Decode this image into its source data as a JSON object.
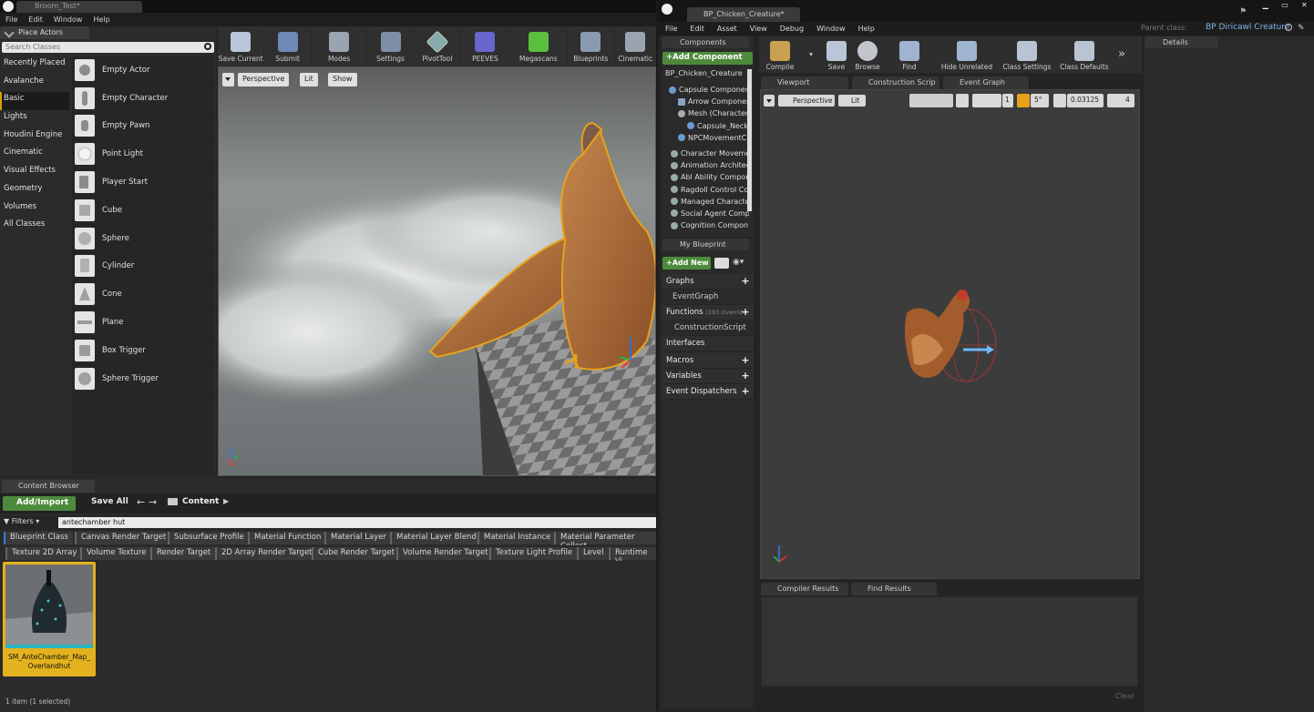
{
  "left_editor": {
    "doc_tab": "Broom_Test*",
    "menu": [
      "File",
      "Edit",
      "Window",
      "Help"
    ],
    "place_actors": {
      "tab_label": "Place Actors",
      "search_placeholder": "Search Classes",
      "categories": [
        "Recently Placed",
        "Avalanche",
        "Basic",
        "Lights",
        "Houdini Engine",
        "Cinematic",
        "Visual Effects",
        "Geometry",
        "Volumes",
        "All Classes"
      ],
      "selected_category": "Basic",
      "items": [
        "Empty Actor",
        "Empty Character",
        "Empty Pawn",
        "Point Light",
        "Player Start",
        "Cube",
        "Sphere",
        "Cylinder",
        "Cone",
        "Plane",
        "Box Trigger",
        "Sphere Trigger"
      ]
    },
    "toolbar": [
      {
        "label": "Save Current",
        "icon": "save-icon",
        "color": "#b9c6d8"
      },
      {
        "label": "Submit",
        "icon": "source-control-icon",
        "color": "#6f89b6"
      },
      {
        "label": "Modes",
        "icon": "modes-icon",
        "color": "#9aa4b0"
      },
      {
        "label": "Settings",
        "icon": "settings-icon",
        "color": "#7c8fa6"
      },
      {
        "label": "PivotTool",
        "icon": "cube-outline-icon",
        "color": "#5a5a5a"
      },
      {
        "label": "PEEVES",
        "icon": "peeves-icon",
        "color": "#6666cc"
      },
      {
        "label": "Megascans",
        "icon": "megascans-icon",
        "color": "#5bbf3e"
      },
      {
        "label": "Blueprints",
        "icon": "blueprints-icon",
        "color": "#8a9ab0"
      },
      {
        "label": "Cinematic",
        "icon": "clapper-icon",
        "color": "#9aa4b0"
      }
    ],
    "viewport": {
      "perspective": "Perspective",
      "lit": "Lit",
      "show": "Show"
    },
    "content_browser": {
      "tab_label": "Content Browser",
      "add_import": "Add/Import",
      "save_all": "Save All",
      "path": "Content",
      "filters_label": "Filters",
      "search_value": "antechamber hut",
      "filter_row1": [
        "Blueprint Class",
        "Canvas Render Target",
        "Subsurface Profile",
        "Material Function",
        "Material Layer",
        "Material Layer Blend",
        "Material Instance",
        "Material Parameter Collect"
      ],
      "filter_row2": [
        "Texture 2D Array",
        "Volume Texture",
        "Render Target",
        "2D Array Render Target",
        "Cube Render Target",
        "Volume Render Target",
        "Texture Light Profile",
        "Level",
        "Runtime Vi"
      ],
      "asset_name_line1": "SM_AnteChamber_Map_",
      "asset_name_line2": "Overlandhut",
      "status": "1 item (1 selected)"
    }
  },
  "right_editor": {
    "doc_tab": "BP_Chicken_Creature*",
    "parent_class_label": "Parent class:",
    "parent_class_value": "BP Diricawl Creature",
    "menu": [
      "File",
      "Edit",
      "Asset",
      "View",
      "Debug",
      "Window",
      "Help"
    ],
    "components": {
      "tab_label": "Components",
      "add_component": "+Add Component",
      "root": "BP_Chicken_Creature",
      "tree": [
        {
          "label": "Capsule Componer",
          "indent": 1
        },
        {
          "label": "Arrow Componer",
          "indent": 2
        },
        {
          "label": "Mesh (Character",
          "indent": 2
        },
        {
          "label": "Capsule_Neckt",
          "indent": 3
        },
        {
          "label": "NPCMovementC",
          "indent": 2
        },
        {
          "label": "Character Moveme",
          "indent": 1
        },
        {
          "label": "Animation Architec",
          "indent": 1
        },
        {
          "label": "Abl Ability Compor",
          "indent": 1
        },
        {
          "label": "Ragdoll Control Co",
          "indent": 1
        },
        {
          "label": "Managed Characte",
          "indent": 1
        },
        {
          "label": "Social Agent Comp",
          "indent": 1
        },
        {
          "label": "Cognition Compon",
          "indent": 1
        }
      ]
    },
    "my_blueprint": {
      "tab_label": "My Blueprint",
      "add_new": "+Add New",
      "sections": {
        "graphs": "Graphs",
        "event_graph": "EventGraph",
        "functions": "Functions",
        "functions_note": "(193 Overrid",
        "construction_script": "ConstructionScript",
        "interfaces": "Interfaces",
        "macros": "Macros",
        "variables": "Variables",
        "event_dispatchers": "Event Dispatchers"
      }
    },
    "toolbar": [
      {
        "label": "Compile",
        "icon": "compile-icon",
        "color": "#c9a050"
      },
      {
        "label": "Save",
        "icon": "save-icon",
        "color": "#b9c6d8"
      },
      {
        "label": "Browse",
        "icon": "browse-icon",
        "color": "#c0c6cc"
      },
      {
        "label": "Find",
        "icon": "find-icon",
        "color": "#9fb4d0"
      },
      {
        "label": "Hide Unrelated",
        "icon": "hide-unrelated-icon",
        "color": "#9fb4d0"
      },
      {
        "label": "Class Settings",
        "icon": "class-settings-icon",
        "color": "#b8c4d2"
      },
      {
        "label": "Class Defaults",
        "icon": "class-defaults-icon",
        "color": "#b8c4d2"
      }
    ],
    "graph_tabs": [
      "Viewport",
      "Construction Scrip",
      "Event Graph"
    ],
    "viewport": {
      "perspective": "Perspective",
      "lit": "Lit",
      "grid_value": "1",
      "angle_value": "5°",
      "scale_value": "0.03125",
      "speed_value": "4"
    },
    "details_tab": "Details",
    "compiler_results_tab": "Compiler Results",
    "find_results_tab": "Find Results",
    "clear_button": "Clear"
  }
}
